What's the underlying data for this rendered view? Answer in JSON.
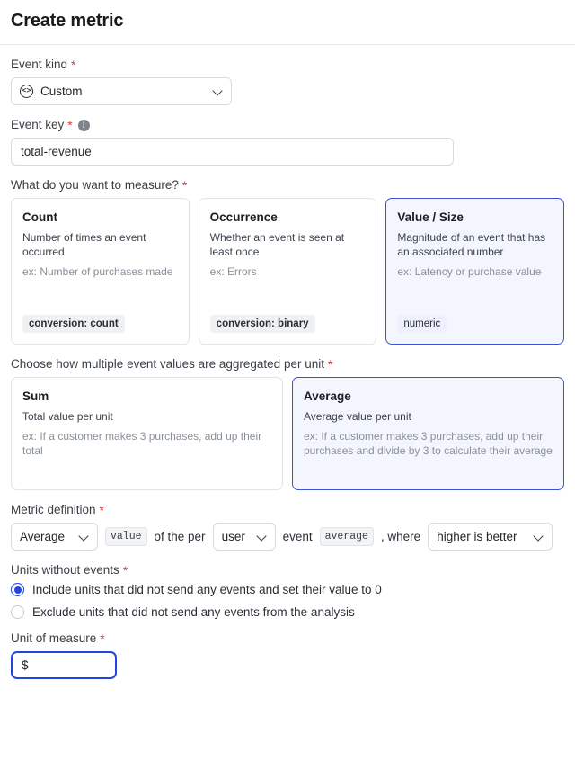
{
  "header": {
    "title": "Create metric"
  },
  "event_kind": {
    "label": "Event kind",
    "required_mark": "*",
    "icon": "code-circle-icon",
    "value": "Custom",
    "caret": "chevron-down-icon"
  },
  "event_key": {
    "label": "Event key",
    "required_mark": "*",
    "info_icon": "info-icon",
    "info_glyph": "i",
    "value": "total-revenue",
    "placeholder": ""
  },
  "measure": {
    "label": "What do you want to measure?",
    "required_mark": "*",
    "options": [
      {
        "title": "Count",
        "desc": "Number of times an event occurred",
        "example": "ex: Number of purchases made",
        "badge": "conversion: count",
        "selected": false
      },
      {
        "title": "Occurrence",
        "desc": "Whether an event is seen at least once",
        "example": "ex: Errors",
        "badge": "conversion: binary",
        "selected": false
      },
      {
        "title": "Value / Size",
        "desc": "Magnitude of an event that has an associated number",
        "example": "ex: Latency or purchase value",
        "badge": "numeric",
        "selected": true
      }
    ]
  },
  "aggregation": {
    "label": "Choose how multiple event values are aggregated per unit",
    "required_mark": "*",
    "options": [
      {
        "title": "Sum",
        "desc": "Total value per unit",
        "example": "ex: If a customer makes 3 purchases, add up their total",
        "selected": false
      },
      {
        "title": "Average",
        "desc": "Average value per unit",
        "example": "ex: If a customer makes 3 purchases, add up their purchases and divide by 3 to calculate their average",
        "selected": true
      }
    ]
  },
  "definition": {
    "label": "Metric definition",
    "required_mark": "*",
    "aggregation_value": "Average",
    "value_chip": "value",
    "text_of_the_per": "of the per",
    "unit_value": "user",
    "text_event": "event",
    "average_chip": "average",
    "text_where": ", where",
    "direction_value": "higher is better"
  },
  "units_without_events": {
    "label": "Units without events",
    "required_mark": "*",
    "options": [
      {
        "text": "Include units that did not send any events and set their value to 0",
        "checked": true
      },
      {
        "text": "Exclude units that did not send any events from the analysis",
        "checked": false
      }
    ]
  },
  "unit_of_measure": {
    "label": "Unit of measure",
    "required_mark": "*",
    "value": "$",
    "placeholder": ""
  },
  "colors": {
    "accent": "#1f46e0",
    "selected_card_border": "#3f51d4",
    "selected_card_bg": "#f4f6fe",
    "required": "#d23f3f",
    "border": "#d8dade"
  }
}
